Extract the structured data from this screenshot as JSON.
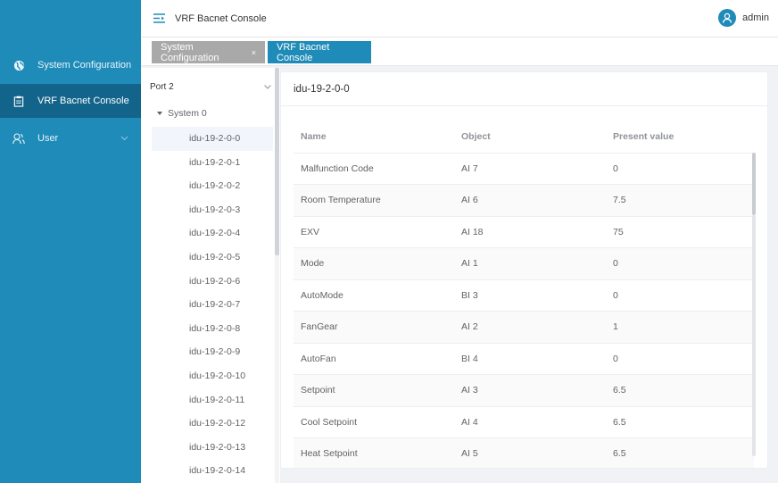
{
  "sidebar": {
    "items": [
      {
        "label": "System Configuration",
        "icon": "globe-icon"
      },
      {
        "label": "VRF Bacnet Console",
        "icon": "clipboard-icon"
      },
      {
        "label": "User",
        "icon": "users-icon"
      }
    ]
  },
  "header": {
    "title": "VRF Bacnet Console",
    "user": "admin"
  },
  "tabs": [
    {
      "label": "System Configuration",
      "close": "×"
    },
    {
      "label": "VRF Bacnet Console"
    }
  ],
  "tree": {
    "port": "Port 2",
    "system": "System 0",
    "leaves": [
      "idu-19-2-0-0",
      "idu-19-2-0-1",
      "idu-19-2-0-2",
      "idu-19-2-0-3",
      "idu-19-2-0-4",
      "idu-19-2-0-5",
      "idu-19-2-0-6",
      "idu-19-2-0-7",
      "idu-19-2-0-8",
      "idu-19-2-0-9",
      "idu-19-2-0-10",
      "idu-19-2-0-11",
      "idu-19-2-0-12",
      "idu-19-2-0-13",
      "idu-19-2-0-14"
    ]
  },
  "detail": {
    "title": "idu-19-2-0-0",
    "columns": [
      "Name",
      "Object",
      "Present value"
    ],
    "rows": [
      {
        "name": "Malfunction Code",
        "object": "AI 7",
        "value": "0"
      },
      {
        "name": "Room Temperature",
        "object": "AI 6",
        "value": "7.5"
      },
      {
        "name": "EXV",
        "object": "AI 18",
        "value": "75"
      },
      {
        "name": "Mode",
        "object": "AI 1",
        "value": "0"
      },
      {
        "name": "AutoMode",
        "object": "BI 3",
        "value": "0"
      },
      {
        "name": "FanGear",
        "object": "AI 2",
        "value": "1"
      },
      {
        "name": "AutoFan",
        "object": "BI 4",
        "value": "0"
      },
      {
        "name": "Setpoint",
        "object": "AI 3",
        "value": "6.5"
      },
      {
        "name": "Cool Setpoint",
        "object": "AI 4",
        "value": "6.5"
      },
      {
        "name": "Heat Setpoint",
        "object": "AI 5",
        "value": "6.5"
      }
    ]
  },
  "colors": {
    "sidebar_bg": "#1f8bb8",
    "sidebar_active": "#13648a",
    "tab_inactive": "#a9a9a9",
    "accent": "#1f8bb8"
  }
}
